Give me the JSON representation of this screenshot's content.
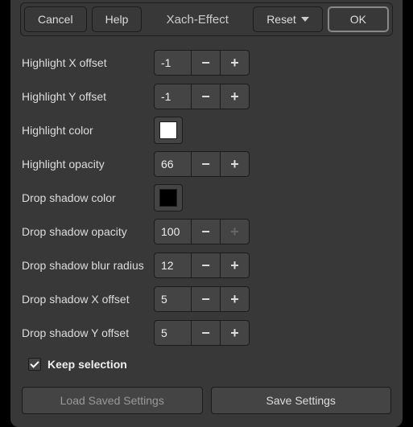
{
  "toolbar": {
    "cancel": "Cancel",
    "help": "Help",
    "title": "Xach-Effect",
    "reset": "Reset",
    "ok": "OK"
  },
  "fields": {
    "hlx": {
      "label": "Highlight X offset",
      "value": "-1"
    },
    "hly": {
      "label": "Highlight Y offset",
      "value": "-1"
    },
    "hlc": {
      "label": "Highlight color",
      "color": "#ffffff"
    },
    "hlo": {
      "label": "Highlight opacity",
      "value": "66"
    },
    "dsc": {
      "label": "Drop shadow color",
      "color": "#000000"
    },
    "dso": {
      "label": "Drop shadow opacity",
      "value": "100"
    },
    "dsb": {
      "label": "Drop shadow blur radius",
      "value": "12"
    },
    "dsx": {
      "label": "Drop shadow X offset",
      "value": "5"
    },
    "dsy": {
      "label": "Drop shadow Y offset",
      "value": "5"
    }
  },
  "keep": "Keep selection",
  "footer": {
    "load": "Load Saved Settings",
    "save": "Save Settings"
  }
}
